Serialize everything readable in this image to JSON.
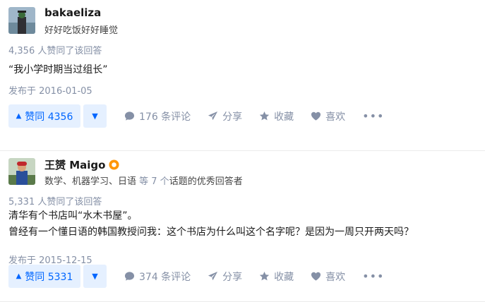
{
  "answers": [
    {
      "author": "bakaeliza",
      "headline": "好好吃饭好好睡觉",
      "vote_text": "4,356 人赞同了该回答",
      "content": [
        "“我小学时期当过组长”"
      ],
      "date": "发布于 2016-01-05",
      "upvote_label": "赞同 4356",
      "comments": "176 条评论",
      "share": "分享",
      "favorite": "收藏",
      "like": "喜欢",
      "more": "•••"
    },
    {
      "author": "王赟 Maigo",
      "headline_topics": "数学、机器学习、日语",
      "headline_mid": " 等 7 个",
      "headline_suffix": "话题的优秀回答者",
      "vote_text": "5,331 人赞同了该回答",
      "content": [
        "清华有个书店叫“水木书屋”。",
        "曾经有一个懂日语的韩国教授问我：这个书店为什么叫这个名字呢？是因为一周只开两天吗？"
      ],
      "date": "发布于 2015-12-15",
      "upvote_label": "赞同 5331",
      "comments": "374 条评论",
      "share": "分享",
      "favorite": "收藏",
      "like": "喜欢",
      "more": "•••"
    }
  ],
  "colors": {
    "accent": "#0066ff",
    "accent_bg": "#e5f0ff",
    "muted": "#8590a6"
  },
  "icons": [
    "comment-icon",
    "share-icon",
    "star-icon",
    "heart-icon",
    "more-icon",
    "upvote-triangle-icon",
    "downvote-triangle-icon",
    "badge-icon"
  ]
}
